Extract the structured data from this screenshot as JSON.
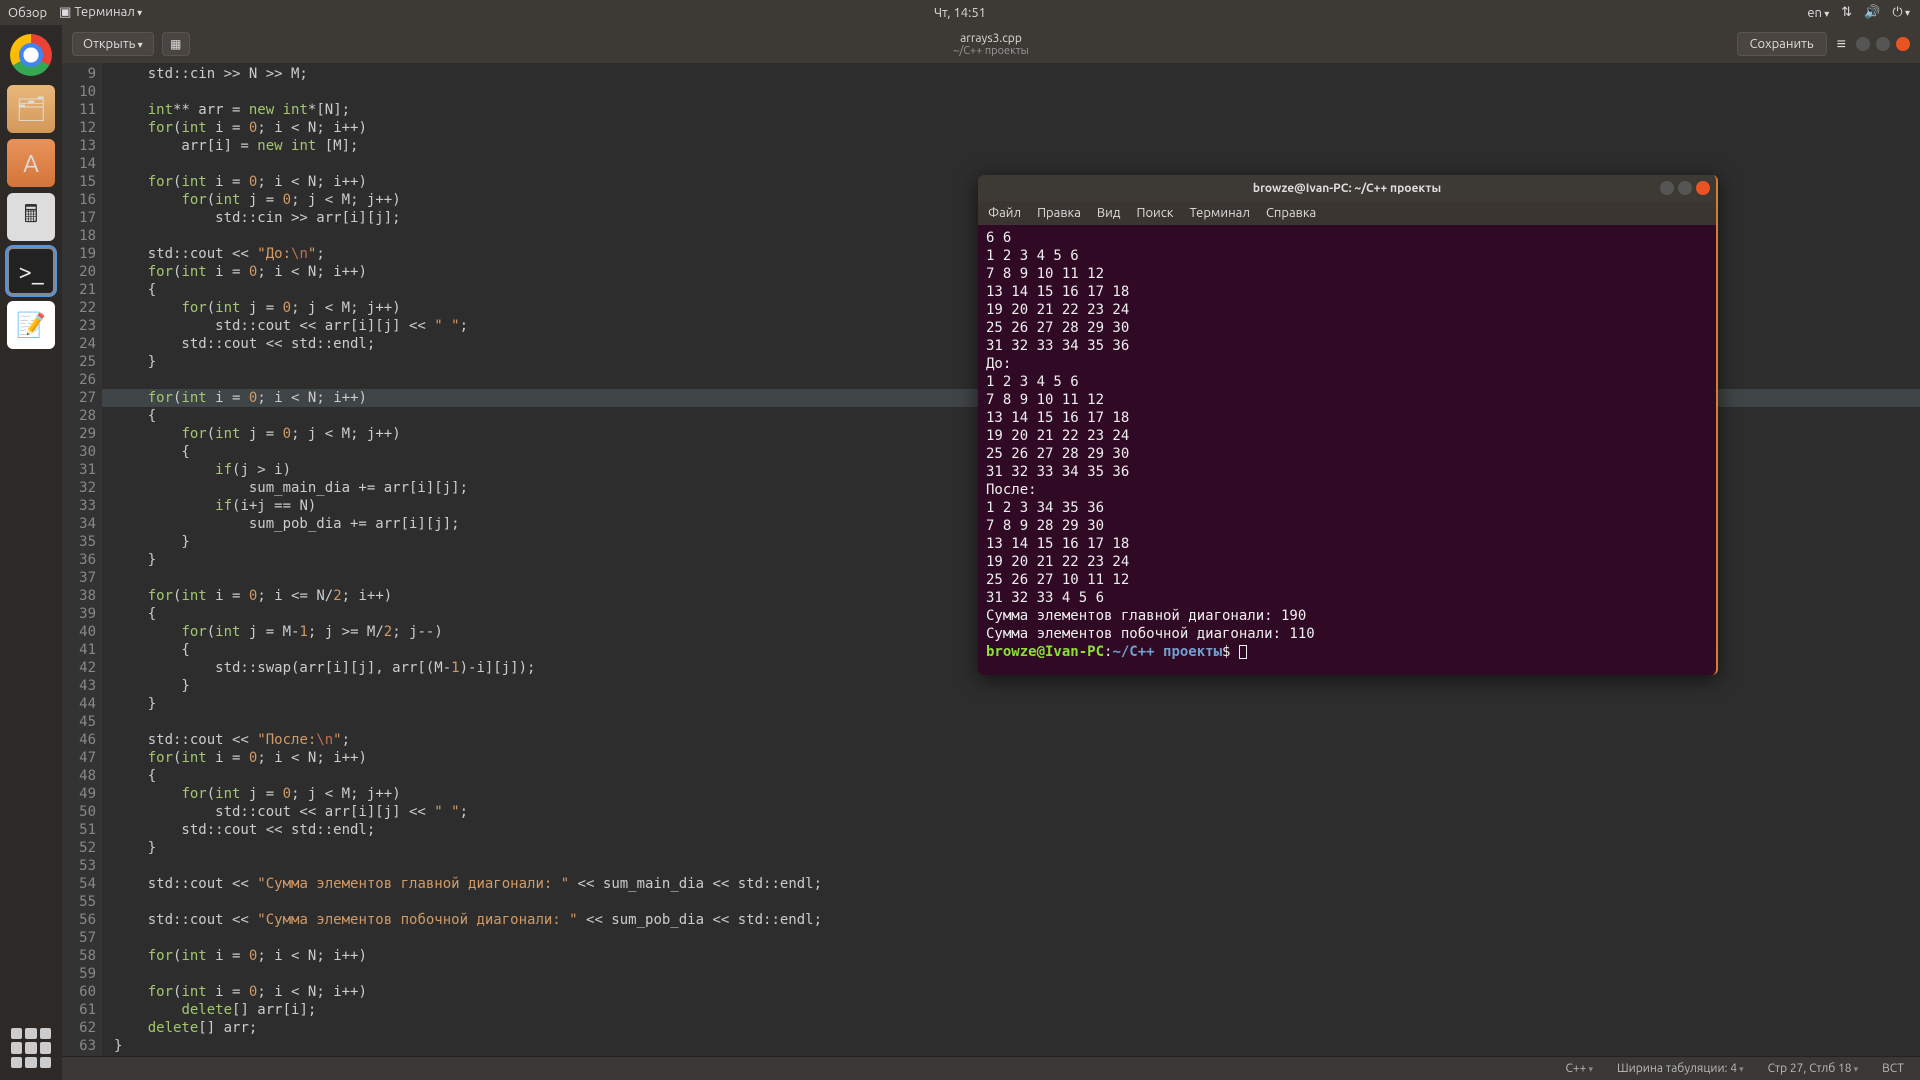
{
  "top_panel": {
    "overview": "Обзор",
    "app_menu": "Терминал",
    "clock": "Чт, 14:51",
    "lang": "en"
  },
  "dock": {
    "items": [
      "chrome",
      "files",
      "software",
      "calc",
      "terminal",
      "notes"
    ]
  },
  "editor": {
    "open_label": "Открыть",
    "title": "arrays3.cpp",
    "subtitle": "~/C++ проекты",
    "save_label": "Сохранить",
    "status": {
      "lang": "C++",
      "tabs": "Ширина табуляции: 4",
      "pos": "Стр 27, Стлб 18",
      "ins": "ВСТ"
    },
    "first_line_no": 9,
    "highlighted_line": 27,
    "code_lines": [
      [
        [
          "    std::cin >> N >> M;",
          ""
        ]
      ],
      [
        [
          "",
          ""
        ]
      ],
      [
        [
          "    ",
          ""
        ],
        [
          "int",
          "type"
        ],
        [
          "** arr = ",
          ""
        ],
        [
          "new",
          "kw"
        ],
        [
          " ",
          ""
        ],
        [
          "int",
          "type"
        ],
        [
          "*[N];",
          ""
        ]
      ],
      [
        [
          "    ",
          ""
        ],
        [
          "for",
          "kw"
        ],
        [
          "(",
          ""
        ],
        [
          "int",
          "type"
        ],
        [
          " i = ",
          ""
        ],
        [
          "0",
          "num"
        ],
        [
          "; i < N; i++)",
          ""
        ]
      ],
      [
        [
          "        arr[i] = ",
          ""
        ],
        [
          "new",
          "kw"
        ],
        [
          " ",
          ""
        ],
        [
          "int",
          "type"
        ],
        [
          " [M];",
          ""
        ]
      ],
      [
        [
          "",
          ""
        ]
      ],
      [
        [
          "    ",
          ""
        ],
        [
          "for",
          "kw"
        ],
        [
          "(",
          ""
        ],
        [
          "int",
          "type"
        ],
        [
          " i = ",
          ""
        ],
        [
          "0",
          "num"
        ],
        [
          "; i < N; i++)",
          ""
        ]
      ],
      [
        [
          "        ",
          ""
        ],
        [
          "for",
          "kw"
        ],
        [
          "(",
          ""
        ],
        [
          "int",
          "type"
        ],
        [
          " j = ",
          ""
        ],
        [
          "0",
          "num"
        ],
        [
          "; j < M; j++)",
          ""
        ]
      ],
      [
        [
          "            std::cin >> arr[i][j];",
          ""
        ]
      ],
      [
        [
          "",
          ""
        ]
      ],
      [
        [
          "    std::cout << ",
          ""
        ],
        [
          "\"До:",
          "str"
        ],
        [
          "\\n",
          "esc"
        ],
        [
          "\"",
          "str"
        ],
        [
          ";",
          ""
        ]
      ],
      [
        [
          "    ",
          ""
        ],
        [
          "for",
          "kw"
        ],
        [
          "(",
          ""
        ],
        [
          "int",
          "type"
        ],
        [
          " i = ",
          ""
        ],
        [
          "0",
          "num"
        ],
        [
          "; i < N; i++)",
          ""
        ]
      ],
      [
        [
          "    {",
          ""
        ]
      ],
      [
        [
          "        ",
          ""
        ],
        [
          "for",
          "kw"
        ],
        [
          "(",
          ""
        ],
        [
          "int",
          "type"
        ],
        [
          " j = ",
          ""
        ],
        [
          "0",
          "num"
        ],
        [
          "; j < M; j++)",
          ""
        ]
      ],
      [
        [
          "            std::cout << arr[i][j] << ",
          ""
        ],
        [
          "\" \"",
          "str"
        ],
        [
          ";",
          ""
        ]
      ],
      [
        [
          "        std::cout << std::endl;",
          ""
        ]
      ],
      [
        [
          "    }",
          ""
        ]
      ],
      [
        [
          "",
          ""
        ]
      ],
      [
        [
          "    ",
          ""
        ],
        [
          "for",
          "kw"
        ],
        [
          "(",
          ""
        ],
        [
          "int",
          "type"
        ],
        [
          " i = ",
          ""
        ],
        [
          "0",
          "num"
        ],
        [
          "; i < N; i++)",
          ""
        ]
      ],
      [
        [
          "    {",
          ""
        ]
      ],
      [
        [
          "        ",
          ""
        ],
        [
          "for",
          "kw"
        ],
        [
          "(",
          ""
        ],
        [
          "int",
          "type"
        ],
        [
          " j = ",
          ""
        ],
        [
          "0",
          "num"
        ],
        [
          "; j < M; j++)",
          ""
        ]
      ],
      [
        [
          "        {",
          ""
        ]
      ],
      [
        [
          "            ",
          ""
        ],
        [
          "if",
          "kw"
        ],
        [
          "(j > i)",
          ""
        ]
      ],
      [
        [
          "                sum_main_dia += arr[i][j];",
          ""
        ]
      ],
      [
        [
          "            ",
          ""
        ],
        [
          "if",
          "kw"
        ],
        [
          "(i+j == N)",
          ""
        ]
      ],
      [
        [
          "                sum_pob_dia += arr[i][j];",
          ""
        ]
      ],
      [
        [
          "        }",
          ""
        ]
      ],
      [
        [
          "    }",
          ""
        ]
      ],
      [
        [
          "",
          ""
        ]
      ],
      [
        [
          "    ",
          ""
        ],
        [
          "for",
          "kw"
        ],
        [
          "(",
          ""
        ],
        [
          "int",
          "type"
        ],
        [
          " i = ",
          ""
        ],
        [
          "0",
          "num"
        ],
        [
          "; i <= N/",
          ""
        ],
        [
          "2",
          "num"
        ],
        [
          "; i++)",
          ""
        ]
      ],
      [
        [
          "    {",
          ""
        ]
      ],
      [
        [
          "        ",
          ""
        ],
        [
          "for",
          "kw"
        ],
        [
          "(",
          ""
        ],
        [
          "int",
          "type"
        ],
        [
          " j = M-",
          ""
        ],
        [
          "1",
          "num"
        ],
        [
          "; j >= M/",
          ""
        ],
        [
          "2",
          "num"
        ],
        [
          "; j--)",
          ""
        ]
      ],
      [
        [
          "        {",
          ""
        ]
      ],
      [
        [
          "            std::swap(arr[i][j], arr[(M-",
          ""
        ],
        [
          "1",
          "num"
        ],
        [
          ")-i][j]);",
          ""
        ]
      ],
      [
        [
          "        }",
          ""
        ]
      ],
      [
        [
          "    }",
          ""
        ]
      ],
      [
        [
          "",
          ""
        ]
      ],
      [
        [
          "    std::cout << ",
          ""
        ],
        [
          "\"После:",
          "str"
        ],
        [
          "\\n",
          "esc"
        ],
        [
          "\"",
          "str"
        ],
        [
          ";",
          ""
        ]
      ],
      [
        [
          "    ",
          ""
        ],
        [
          "for",
          "kw"
        ],
        [
          "(",
          ""
        ],
        [
          "int",
          "type"
        ],
        [
          " i = ",
          ""
        ],
        [
          "0",
          "num"
        ],
        [
          "; i < N; i++)",
          ""
        ]
      ],
      [
        [
          "    {",
          ""
        ]
      ],
      [
        [
          "        ",
          ""
        ],
        [
          "for",
          "kw"
        ],
        [
          "(",
          ""
        ],
        [
          "int",
          "type"
        ],
        [
          " j = ",
          ""
        ],
        [
          "0",
          "num"
        ],
        [
          "; j < M; j++)",
          ""
        ]
      ],
      [
        [
          "            std::cout << arr[i][j] << ",
          ""
        ],
        [
          "\" \"",
          "str"
        ],
        [
          ";",
          ""
        ]
      ],
      [
        [
          "        std::cout << std::endl;",
          ""
        ]
      ],
      [
        [
          "    }",
          ""
        ]
      ],
      [
        [
          "",
          ""
        ]
      ],
      [
        [
          "    std::cout << ",
          ""
        ],
        [
          "\"Сумма элементов главной диагонали: \"",
          "str"
        ],
        [
          " << sum_main_dia << std::endl;",
          ""
        ]
      ],
      [
        [
          "",
          ""
        ]
      ],
      [
        [
          "    std::cout << ",
          ""
        ],
        [
          "\"Сумма элементов побочной диагонали: \"",
          "str"
        ],
        [
          " << sum_pob_dia << std::endl;",
          ""
        ]
      ],
      [
        [
          "",
          ""
        ]
      ],
      [
        [
          "    ",
          ""
        ],
        [
          "for",
          "kw"
        ],
        [
          "(",
          ""
        ],
        [
          "int",
          "type"
        ],
        [
          " i = ",
          ""
        ],
        [
          "0",
          "num"
        ],
        [
          "; i < N; i++)",
          ""
        ]
      ],
      [
        [
          "",
          ""
        ]
      ],
      [
        [
          "    ",
          ""
        ],
        [
          "for",
          "kw"
        ],
        [
          "(",
          ""
        ],
        [
          "int",
          "type"
        ],
        [
          " i = ",
          ""
        ],
        [
          "0",
          "num"
        ],
        [
          "; i < N; i++)",
          ""
        ]
      ],
      [
        [
          "        ",
          ""
        ],
        [
          "delete",
          "kw"
        ],
        [
          "[] arr[i];",
          ""
        ]
      ],
      [
        [
          "    ",
          ""
        ],
        [
          "delete",
          "kw"
        ],
        [
          "[] arr;",
          ""
        ]
      ],
      [
        [
          "}",
          ""
        ]
      ]
    ]
  },
  "terminal": {
    "title": "browze@Ivan-PC: ~/C++ проекты",
    "menu": [
      "Файл",
      "Правка",
      "Вид",
      "Поиск",
      "Терминал",
      "Справка"
    ],
    "output": [
      "6 6",
      "1 2 3 4 5 6",
      "7 8 9 10 11 12",
      "13 14 15 16 17 18",
      "19 20 21 22 23 24",
      "25 26 27 28 29 30",
      "31 32 33 34 35 36",
      "До:",
      "1 2 3 4 5 6 ",
      "7 8 9 10 11 12 ",
      "13 14 15 16 17 18 ",
      "19 20 21 22 23 24 ",
      "25 26 27 28 29 30 ",
      "31 32 33 34 35 36 ",
      "После:",
      "1 2 3 34 35 36 ",
      "7 8 9 28 29 30 ",
      "13 14 15 16 17 18 ",
      "19 20 21 22 23 24 ",
      "25 26 27 10 11 12 ",
      "31 32 33 4 5 6 ",
      "Сумма элементов главной диагонали: 190",
      "Сумма элементов побочной диагонали: 110"
    ],
    "prompt_user": "browze@Ivan-PC",
    "prompt_path": "~/C++ проекты",
    "prompt_suffix": "$"
  }
}
